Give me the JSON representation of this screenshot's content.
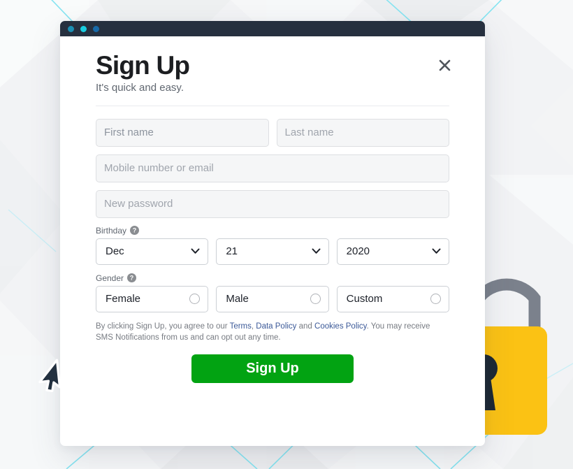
{
  "window": {
    "dots": [
      {
        "name": "window-dot-1",
        "color": "#1b8fb3"
      },
      {
        "name": "window-dot-2",
        "color": "#19cde0"
      },
      {
        "name": "window-dot-3",
        "color": "#1769a8"
      }
    ]
  },
  "header": {
    "title": "Sign Up",
    "subtitle": "It's quick and easy.",
    "close_icon": "close-icon"
  },
  "form": {
    "first_name_placeholder": "First name",
    "last_name_placeholder": "Last name",
    "contact_placeholder": "Mobile number or email",
    "password_placeholder": "New password",
    "first_name_value": "",
    "last_name_value": "",
    "contact_value": "",
    "password_value": "",
    "birthday": {
      "label": "Birthday",
      "help_icon": "question-mark-icon",
      "month": "Dec",
      "day": "21",
      "year": "2020",
      "chevron_icon": "chevron-down-icon"
    },
    "gender": {
      "label": "Gender",
      "help_icon": "question-mark-icon",
      "options": [
        {
          "label": "Female",
          "selected": false
        },
        {
          "label": "Male",
          "selected": false
        },
        {
          "label": "Custom",
          "selected": false
        }
      ]
    },
    "terms": {
      "part1": "By clicking Sign Up, you agree to our ",
      "link_terms": "Terms",
      "sep1": ", ",
      "link_data_policy": "Data Policy",
      "sep2": " and ",
      "link_cookies_policy": "Cookies Policy",
      "part2": ". You may receive SMS Notifications from us and can opt out any time."
    },
    "submit_label": "Sign Up",
    "submit_color": "#02a312"
  },
  "decor": {
    "padlock_body_color": "#fbc214",
    "padlock_shackle_color": "#7b818c",
    "padlock_keyhole_color": "#1c2733",
    "background_color": "#f2f3f5",
    "accent_line_color": "#7fe3f0",
    "cursor_color": "#22303f"
  }
}
